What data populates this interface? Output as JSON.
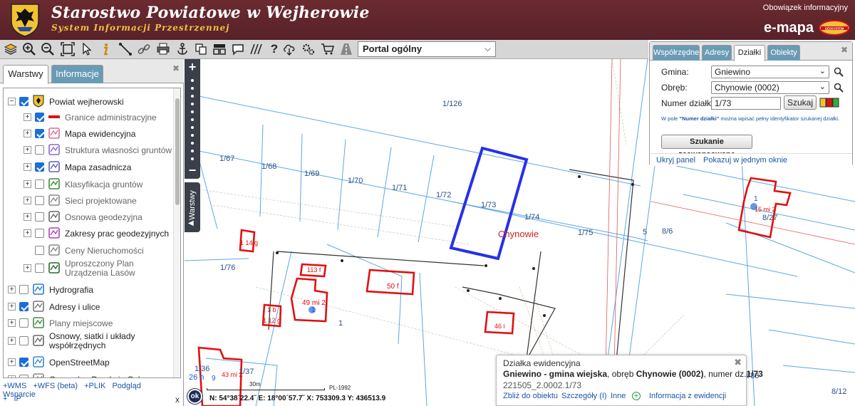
{
  "header": {
    "title": "Starostwo Powiatowe w Wejherowie",
    "subtitle": "System Informacji Przestrzennej",
    "obligation_link": "Obowiązek informacyjny",
    "brand": "e-mapa",
    "brand_logo_text": "GEOSYSTEM"
  },
  "toolbar": {
    "icons": [
      "layers-icon",
      "zoom-in-icon",
      "zoom-out-icon",
      "zoom-extent-icon",
      "select-arrow-icon",
      "info-icon",
      "measure-line-icon",
      "link-icon",
      "print-icon",
      "anchor-icon",
      "copy-icon",
      "layout-icon",
      "comment-icon",
      "hatch-icon",
      "help-icon",
      "cloud-download-icon",
      "settings-icon",
      "cart-icon",
      "road-icon"
    ],
    "portal": "Portal ogólny"
  },
  "left_panel": {
    "tabs": [
      "Warstwy",
      "Informacje"
    ],
    "active_tab": "Warstwy",
    "layers": [
      {
        "label": "Powiat wejherowski",
        "checked": true,
        "level": 0,
        "expander": "−",
        "active": true
      },
      {
        "label": "Granice administracyjne",
        "checked": true,
        "level": 1,
        "expander": "+",
        "active": false
      },
      {
        "label": "Mapa ewidencyjna",
        "checked": true,
        "level": 1,
        "expander": "+",
        "active": true
      },
      {
        "label": "Struktura własności gruntów",
        "checked": false,
        "level": 1,
        "expander": "+",
        "active": false
      },
      {
        "label": "Mapa zasadnicza",
        "checked": true,
        "level": 1,
        "expander": "+",
        "active": true
      },
      {
        "label": "Klasyfikacja gruntów",
        "checked": false,
        "level": 1,
        "expander": "+",
        "active": false
      },
      {
        "label": "Sieci projektowane",
        "checked": false,
        "level": 1,
        "expander": "+",
        "active": false
      },
      {
        "label": "Osnowa geodezyjna",
        "checked": false,
        "level": 1,
        "expander": "+",
        "active": false
      },
      {
        "label": "Zakresy prac geodezyjnych",
        "checked": false,
        "level": 1,
        "expander": "+",
        "active": true
      },
      {
        "label": "Ceny Nieruchomości",
        "checked": false,
        "level": 1,
        "expander": "",
        "active": false
      },
      {
        "label": "Uproszczony Plan Urządzenia Lasów",
        "checked": false,
        "level": 1,
        "expander": "+",
        "active": false
      },
      {
        "label": "Hydrografia",
        "checked": false,
        "level": 0,
        "expander": "+",
        "active": true
      },
      {
        "label": "Adresy i ulice",
        "checked": true,
        "level": 0,
        "expander": "+",
        "active": true
      },
      {
        "label": "Plany miejscowe",
        "checked": false,
        "level": 0,
        "expander": "+",
        "active": false
      },
      {
        "label": "Osnowy, siatki i układy współrzędnych",
        "checked": false,
        "level": 0,
        "expander": "+",
        "active": true
      },
      {
        "label": "OpenStreetMap",
        "checked": true,
        "level": 0,
        "expander": "+",
        "active": true
      },
      {
        "label": "Generalna Dyrekcja Ochrony",
        "checked": false,
        "level": 0,
        "expander": "+",
        "active": true
      }
    ],
    "links_row1": [
      "+WMS",
      "+WFS (beta)",
      "+PLIK",
      "Podgląd",
      "Wsparcie"
    ],
    "links_row2": "IP",
    "close_x": "x"
  },
  "map_controls": {
    "plus": "+",
    "minus": "−",
    "layers_tab": "Warstwy"
  },
  "search_panel": {
    "tabs": [
      "Współrzędne",
      "Adresy",
      "Działki",
      "Obiekty"
    ],
    "active_tab": "Działki",
    "gmina_label": "Gmina:",
    "gmina_value": "Gniewino",
    "obreb_label": "Obręb:",
    "obreb_value": "Chynowie (0002)",
    "parcel_label": "Numer działki:",
    "parcel_value": "1/73",
    "search_button": "Szukaj",
    "hint_prefix": "W pole ",
    "hint_bold": "\"Numer działki\"",
    "hint_suffix": " można wpisać pełny identyfikator szukanej działki.",
    "advanced_button": "Szukanie zaawansowane",
    "hide_panel": "Ukryj panel",
    "show_in_one": "Pokazuj w jednym oknie"
  },
  "map_labels": {
    "parcels": [
      "1/126",
      "1/67",
      "1/68",
      "1/69",
      "1/70",
      "1/71",
      "1/72",
      "1/73",
      "1/74",
      "1/75",
      "1/76",
      "1/36",
      "1/37",
      "8/6",
      "8/27",
      "8/33",
      "8/12",
      "5",
      "1"
    ],
    "village": "Chynowie",
    "buildings": [
      "1 14 g",
      "113 f",
      "50 f",
      "49 mi 2",
      "1 b",
      "1 12 g",
      "46 i",
      "26 h",
      "43 mi 2",
      "15 mi 2"
    ],
    "address_numbers": [
      "1",
      "1",
      "9"
    ]
  },
  "popup": {
    "title": "Działka ewidencyjna",
    "line_b1": "Gniewino - gmina wiejska",
    "line_t1": ", obręb ",
    "line_b2": "Chynowie (0002)",
    "line_t2": ", numer dz.",
    "line_b3": "1/73",
    "identifier": "221505_2.0002.1/73",
    "actions": [
      "Zbliż do obiektu",
      "Szczegóły (I)",
      "Inne",
      "Informacja z ewidencji"
    ]
  },
  "status": {
    "ok": "ok",
    "coords": "N: 54°38´22.4˝  E: 18°00´57.7˝  X: 753309.3  Y: 436513.9",
    "scale_label": "30m",
    "crs": "PL-1992"
  },
  "colors": {
    "header_bg": "#5c2429",
    "subtitle": "#f0c040",
    "selected_parcel": "#2630e8",
    "building": "#e01010",
    "parcel_line": "#5aa7e6",
    "tab_inactive": "#6a9bb5",
    "link": "#1a55a8"
  }
}
